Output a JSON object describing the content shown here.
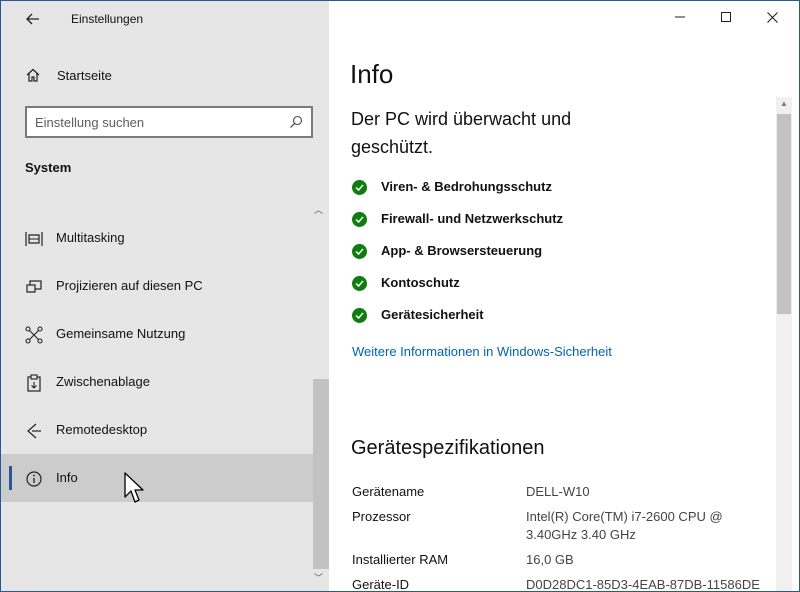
{
  "window": {
    "title": "Einstellungen",
    "controls": {
      "minimize": "—",
      "maximize": "☐",
      "close": "✕"
    }
  },
  "sidebar": {
    "back_icon": "back-arrow-icon",
    "home_label": "Startseite",
    "search_placeholder": "Einstellung suchen",
    "section": "System",
    "items": [
      {
        "label": "Multitasking",
        "icon": "multitasking-icon",
        "selected": false
      },
      {
        "label": "Projizieren auf diesen PC",
        "icon": "project-icon",
        "selected": false
      },
      {
        "label": "Gemeinsame Nutzung",
        "icon": "share-icon",
        "selected": false
      },
      {
        "label": "Zwischenablage",
        "icon": "clipboard-icon",
        "selected": false
      },
      {
        "label": "Remotedesktop",
        "icon": "remote-desktop-icon",
        "selected": false
      },
      {
        "label": "Info",
        "icon": "info-icon",
        "selected": true
      }
    ]
  },
  "main": {
    "title": "Info",
    "status_heading": "Der PC wird überwacht und geschützt.",
    "checks": [
      "Viren- & Bedrohungsschutz",
      "Firewall- und Netzwerkschutz",
      "App- & Browsersteuerung",
      "Kontoschutz",
      "Gerätesicherheit"
    ],
    "more_link": "Weitere Informationen in Windows-Sicherheit",
    "specs_heading": "Gerätespezifikationen",
    "specs": [
      {
        "key": "Gerätename",
        "value": "DELL-W10"
      },
      {
        "key": "Prozessor",
        "value": "Intel(R) Core(TM) i7-2600 CPU @ 3.40GHz   3.40 GHz"
      },
      {
        "key": "Installierter RAM",
        "value": "16,0 GB"
      },
      {
        "key": "Geräte-ID",
        "value": "D0D28DC1-85D3-4EAB-87DB-11586DE"
      }
    ]
  },
  "colors": {
    "accent": "#2b579a",
    "check_green": "#107c10",
    "link": "#0063b1"
  }
}
